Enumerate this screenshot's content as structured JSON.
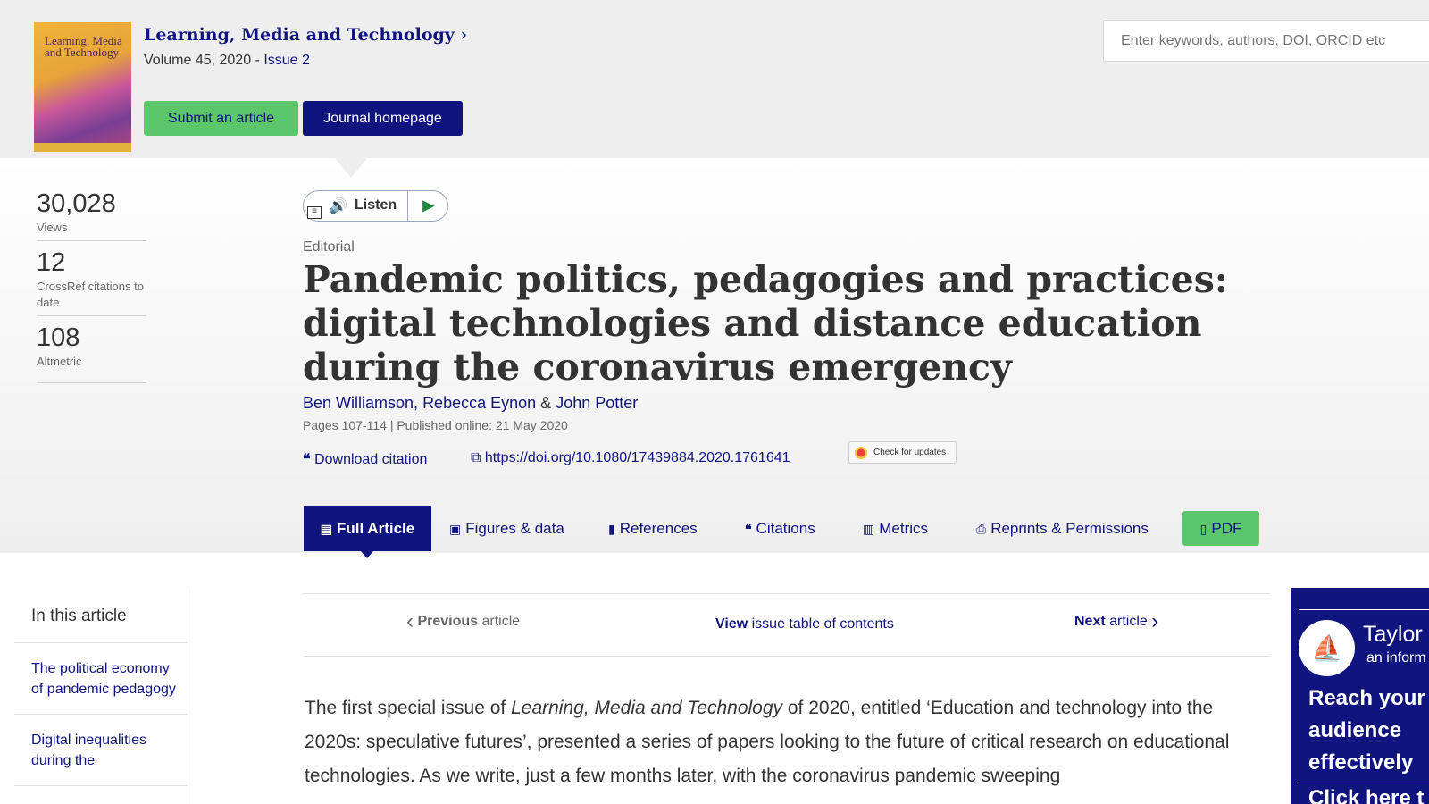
{
  "journal": {
    "cover_title": "Learning, Media and Technology",
    "title": "Learning, Media and Technology",
    "volume": "Volume 45, 2020 - ",
    "issue": "Issue 2",
    "submit_label": "Submit an article",
    "homepage_label": "Journal homepage"
  },
  "search": {
    "placeholder": "Enter keywords, authors, DOI, ORCID etc"
  },
  "metrics": [
    {
      "value": "30,028",
      "label": "Views"
    },
    {
      "value": "12",
      "label": "CrossRef citations to date"
    },
    {
      "value": "108",
      "label": "Altmetric"
    }
  ],
  "listen": {
    "label": "Listen"
  },
  "article": {
    "type": "Editorial",
    "title": "Pandemic politics, pedagogies and practices: digital technologies and distance education during the coronavirus emergency",
    "authors": [
      "Ben Williamson,",
      "Rebecca Eynon",
      "&",
      "John Potter"
    ],
    "pages_published": "Pages 107-114 | Published online: 21 May 2020",
    "download_citation": "Download citation",
    "doi": "https://doi.org/10.1080/17439884.2020.1761641",
    "check_updates": "Check for updates"
  },
  "tabs": {
    "full": "Full Article",
    "figures": "Figures & data",
    "references": "References",
    "citations": "Citations",
    "metrics": "Metrics",
    "reprints": "Reprints & Permissions",
    "pdf": "PDF"
  },
  "toc": {
    "heading": "In this article",
    "items": [
      "The political economy of pandemic pedagogy",
      "Digital inequalities during the"
    ]
  },
  "nav": {
    "prev_bold": "Previous",
    "prev_rest": " article",
    "view_bold": "View",
    "view_rest": " issue table of contents",
    "next_bold": "Next",
    "next_rest": " article"
  },
  "body": {
    "p1_a": "The first special issue of ",
    "p1_italic": "Learning, Media and Technology",
    "p1_b": " of 2020, entitled ‘Education and technology into the 2020s: speculative futures’, presented a series of papers looking to the future of critical research on educational technologies. As we write, just a few months later, with the coronavirus pandemic sweeping"
  },
  "ad": {
    "brand": "Taylor",
    "brand_sub": "an inform",
    "headline": "Reach your audience effectively",
    "cta": "Click here t"
  }
}
